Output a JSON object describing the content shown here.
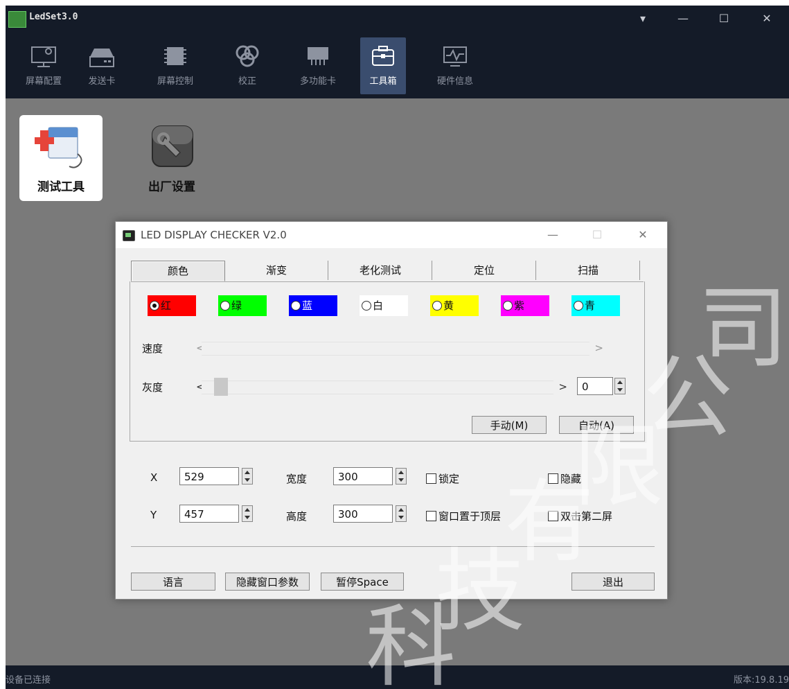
{
  "app": {
    "title": "LedSet3.0"
  },
  "window_controls": {
    "menu": "▾",
    "minimize": "—",
    "maximize": "☐",
    "close": "✕"
  },
  "toolbar": {
    "items": [
      {
        "label": "屏幕配置",
        "icon": "monitor-gear-icon"
      },
      {
        "label": "发送卡",
        "icon": "sender-card-icon"
      },
      {
        "label": "屏幕控制",
        "icon": "chip-icon"
      },
      {
        "label": "校正",
        "icon": "rgb-circles-icon"
      },
      {
        "label": "多功能卡",
        "icon": "multifunction-card-icon"
      },
      {
        "label": "工具箱",
        "icon": "toolbox-icon",
        "active": true
      },
      {
        "label": "硬件信息",
        "icon": "hardware-monitor-icon"
      }
    ]
  },
  "desktop": {
    "items": [
      {
        "label": "测试工具",
        "icon": "test-tool-icon",
        "selected": true
      },
      {
        "label": "出厂设置",
        "icon": "factory-settings-icon"
      }
    ]
  },
  "dialog": {
    "title": "LED DISPLAY CHECKER V2.0",
    "controls": {
      "minimize": "—",
      "maximize": "☐",
      "close": "✕"
    },
    "tabs": [
      "颜色",
      "渐变",
      "老化测试",
      "定位",
      "扫描"
    ],
    "active_tab": "颜色",
    "colors": [
      {
        "label": "红",
        "color": "#ff0000",
        "selected": true
      },
      {
        "label": "绿",
        "color": "#00ff00"
      },
      {
        "label": "蓝",
        "color": "#0000ff"
      },
      {
        "label": "白",
        "color": "#ffffff"
      },
      {
        "label": "黄",
        "color": "#ffff00"
      },
      {
        "label": "紫",
        "color": "#ff00ff"
      },
      {
        "label": "青",
        "color": "#00ffff"
      }
    ],
    "speed": {
      "label": "速度",
      "left_arrow": "<",
      "right_arrow": ">"
    },
    "gray": {
      "label": "灰度",
      "left_arrow": "<",
      "right_arrow": ">",
      "value": "0"
    },
    "buttons": {
      "manual": "手动(M)",
      "auto": "自动(A)"
    },
    "fields": {
      "x_label": "X",
      "x_value": "529",
      "y_label": "Y",
      "y_value": "457",
      "width_label": "宽度",
      "width_value": "300",
      "height_label": "高度",
      "height_value": "300"
    },
    "checkboxes": {
      "lock": "锁定",
      "hide": "隐藏",
      "window_top": "窗口置于顶层",
      "double_click_second": "双击第二屏"
    },
    "bottom_buttons": {
      "language": "语言",
      "hide_params": "隐藏窗口参数",
      "pause": "暂停Space",
      "exit": "退出"
    }
  },
  "status": {
    "left": "设备已连接",
    "right": "版本:19.8.19"
  },
  "watermark": {
    "chars": [
      "公",
      "司",
      "限",
      "有",
      "技",
      "科"
    ]
  }
}
